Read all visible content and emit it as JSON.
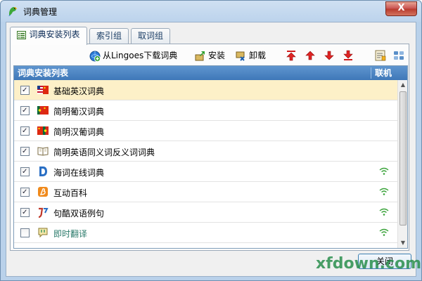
{
  "window": {
    "title": "词典管理",
    "close_glyph": "X",
    "accent_color": "#3f78b8"
  },
  "tabs": [
    {
      "label": "词典安装列表",
      "active": true
    },
    {
      "label": "索引组",
      "active": false
    },
    {
      "label": "取词组",
      "active": false
    }
  ],
  "toolbar": {
    "download_label": "从Lingoes下载词典",
    "install_label": "安装",
    "uninstall_label": "卸载",
    "icons": [
      "move-top-icon",
      "move-up-icon",
      "move-down-icon",
      "move-bottom-icon",
      "properties-icon",
      "view-options-icon"
    ]
  },
  "list": {
    "header_name": "词典安装列表",
    "header_online": "联机",
    "rows": [
      {
        "label": "基础英汉词典",
        "checked": true,
        "icon": "flag-us-cn-icon",
        "online": false,
        "selected": true
      },
      {
        "label": "简明葡汉词典",
        "checked": true,
        "icon": "flag-pt-cn-icon",
        "online": false
      },
      {
        "label": "简明汉葡词典",
        "checked": true,
        "icon": "flag-cn-pt-icon",
        "online": false
      },
      {
        "label": "简明英语同义词反义词词典",
        "checked": true,
        "icon": "book-icon",
        "online": false
      },
      {
        "label": "海词在线词典",
        "checked": true,
        "icon": "dict-d-icon",
        "online": true
      },
      {
        "label": "互动百科",
        "checked": true,
        "icon": "baike-icon",
        "online": true
      },
      {
        "label": "句酷双语例句",
        "checked": true,
        "icon": "jukuu-icon",
        "online": true
      },
      {
        "label": "即时翻译",
        "checked": false,
        "icon": "translate-icon",
        "online": true
      }
    ]
  },
  "footer": {
    "close_label": "关闭"
  },
  "watermark": "xfdown.com"
}
